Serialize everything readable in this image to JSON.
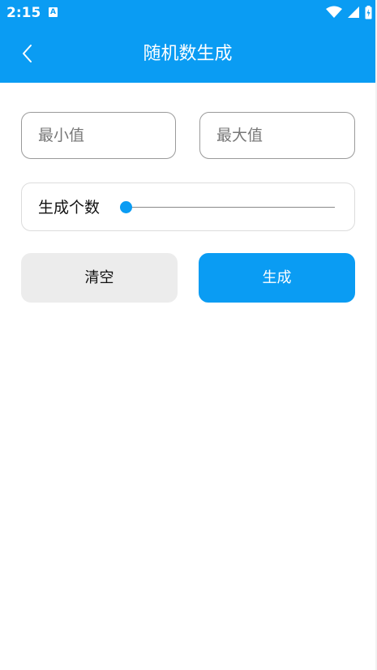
{
  "status_bar": {
    "time": "2:15",
    "notification_icon_letter": "A",
    "icons": [
      "wifi-icon",
      "cellular-signal-icon",
      "battery-charging-icon"
    ]
  },
  "app_bar": {
    "title": "随机数生成",
    "back_icon": "chevron-left-icon"
  },
  "form": {
    "min_placeholder": "最小值",
    "max_placeholder": "最大值",
    "min_value": "",
    "max_value": "",
    "count_label": "生成个数",
    "count_slider_fraction": 0.0
  },
  "buttons": {
    "clear_label": "清空",
    "generate_label": "生成"
  },
  "colors": {
    "primary": "#0a9cf3",
    "clear_button_bg": "#ececec",
    "background": "#ffffff"
  }
}
